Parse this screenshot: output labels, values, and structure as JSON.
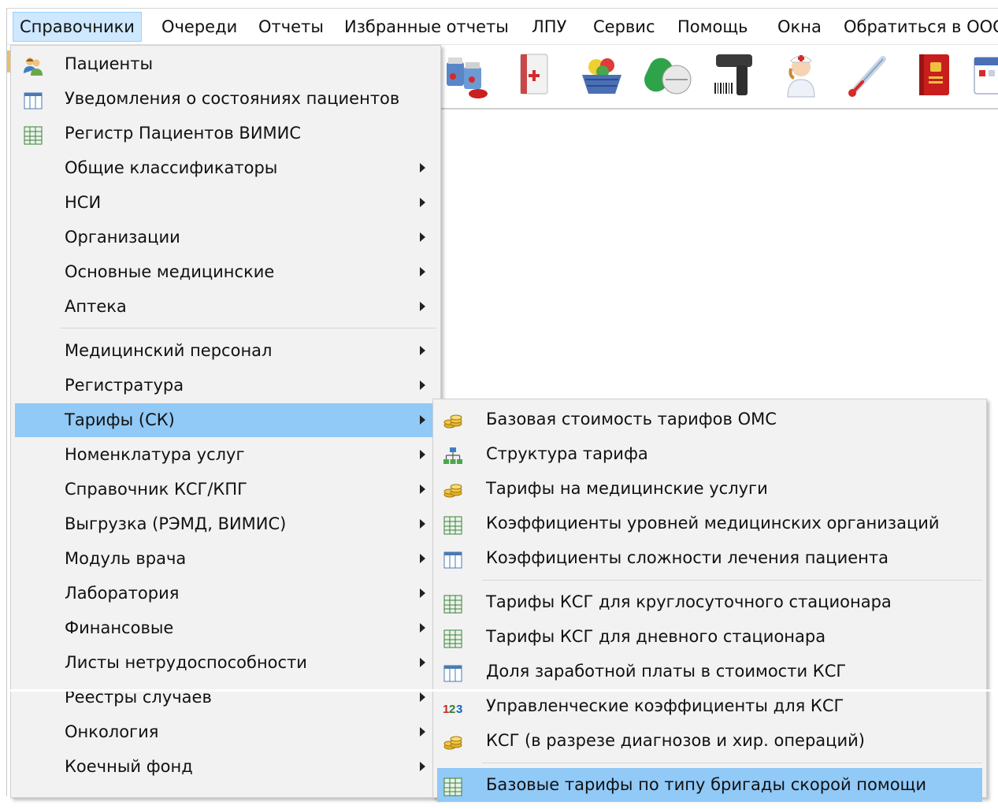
{
  "menubar": {
    "items": [
      "Справочники",
      "Очереди",
      "Отчеты",
      "Избранные отчеты",
      "ЛПУ",
      "Сервис",
      "Помощь",
      "Окна",
      "Обратиться в ООО"
    ]
  },
  "toolbar": {
    "icons": [
      "medicines-icon",
      "medical-book-icon",
      "basket-icon",
      "pills-icon",
      "barcode-scanner-icon",
      "nurse-icon",
      "thermometer-icon",
      "red-book-icon",
      "calendar-icon"
    ]
  },
  "dropdown": {
    "items": [
      {
        "label": "Пациенты",
        "icon": "patients-icon",
        "submenu": false
      },
      {
        "label": "Уведомления о состояниях пациентов",
        "icon": "grid-icon",
        "submenu": false
      },
      {
        "label": "Регистр Пациентов ВИМИС",
        "icon": "table-icon",
        "submenu": false
      },
      {
        "label": "Общие классификаторы",
        "submenu": true
      },
      {
        "label": "НСИ",
        "submenu": true
      },
      {
        "label": "Организации",
        "submenu": true
      },
      {
        "label": "Основные медицинские",
        "submenu": true
      },
      {
        "label": "Аптека",
        "submenu": true
      },
      {
        "label": "Медицинский персонал",
        "submenu": true
      },
      {
        "label": "Регистратура",
        "submenu": true
      },
      {
        "label": "Тарифы (СК)",
        "submenu": true,
        "highlighted": true
      },
      {
        "label": "Номенклатура услуг",
        "submenu": true
      },
      {
        "label": "Справочник КСГ/КПГ",
        "submenu": true
      },
      {
        "label": "Выгрузка (РЭМД, ВИМИС)",
        "submenu": true
      },
      {
        "label": "Модуль врача",
        "submenu": true
      },
      {
        "label": "Лаборатория",
        "submenu": true
      },
      {
        "label": "Финансовые",
        "submenu": true
      },
      {
        "label": "Листы нетрудоспособности",
        "submenu": true
      },
      {
        "label": "Реестры случаев",
        "submenu": true
      },
      {
        "label": "Онкология",
        "submenu": true
      },
      {
        "label": "Коечный фонд",
        "submenu": true
      }
    ]
  },
  "submenu": {
    "items": [
      {
        "label": "Базовая стоимость тарифов ОМС",
        "icon": "coins-icon"
      },
      {
        "label": "Структура тарифа",
        "icon": "hierarchy-icon"
      },
      {
        "label": "Тарифы на медицинские услуги",
        "icon": "coins-icon"
      },
      {
        "label": "Коэффициенты уровней медицинских организаций",
        "icon": "table-icon"
      },
      {
        "label": "Коэффициенты сложности лечения пациента",
        "icon": "grid-icon"
      },
      {
        "label": "Тарифы КСГ для круглосуточного стационара",
        "icon": "table-icon"
      },
      {
        "label": "Тарифы КСГ для дневного стационара",
        "icon": "table-icon"
      },
      {
        "label": "Доля заработной платы в стоимости КСГ",
        "icon": "grid-icon"
      },
      {
        "label": "Управленческие коэффициенты для КСГ",
        "icon": "numbers-icon"
      },
      {
        "label": "КСГ (в разрезе диагнозов и хир. операций)",
        "icon": "coins-icon"
      },
      {
        "label": "Базовые тарифы по типу бригады скорой помощи",
        "icon": "table-icon",
        "highlighted": true
      }
    ]
  },
  "colors": {
    "highlight": "#91c9f7",
    "menu_bg": "#f2f2f2",
    "menubar_open": "#cde8ff"
  }
}
